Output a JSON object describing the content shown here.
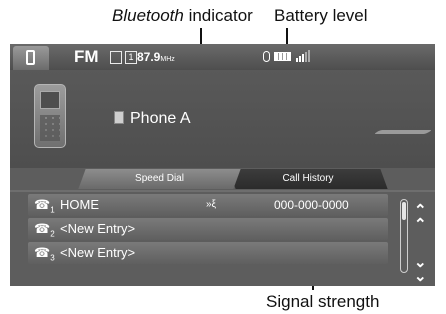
{
  "callouts": {
    "bluetooth_italic": "Bluetooth",
    "bluetooth_rest": " indicator",
    "battery": "Battery level",
    "signal": "Signal strength"
  },
  "status_bar": {
    "band": "FM",
    "preset_icons": [
      "",
      "1"
    ],
    "frequency": "87.9",
    "frequency_unit": "MHz"
  },
  "phone": {
    "name": "Phone A"
  },
  "tabs": [
    {
      "label": "Speed Dial",
      "active": true
    },
    {
      "label": "Call History",
      "active": false
    }
  ],
  "entries": [
    {
      "index": "1",
      "name": "HOME",
      "voice_tag": "»ξ",
      "number": "000-000-0000"
    },
    {
      "index": "2",
      "name": "<New Entry>",
      "voice_tag": "",
      "number": ""
    },
    {
      "index": "3",
      "name": "<New Entry>",
      "voice_tag": "",
      "number": ""
    }
  ],
  "colors": {
    "screen_bg": "#5d5d5d",
    "row_bg": "#6c6c6c",
    "text": "#ffffff"
  }
}
